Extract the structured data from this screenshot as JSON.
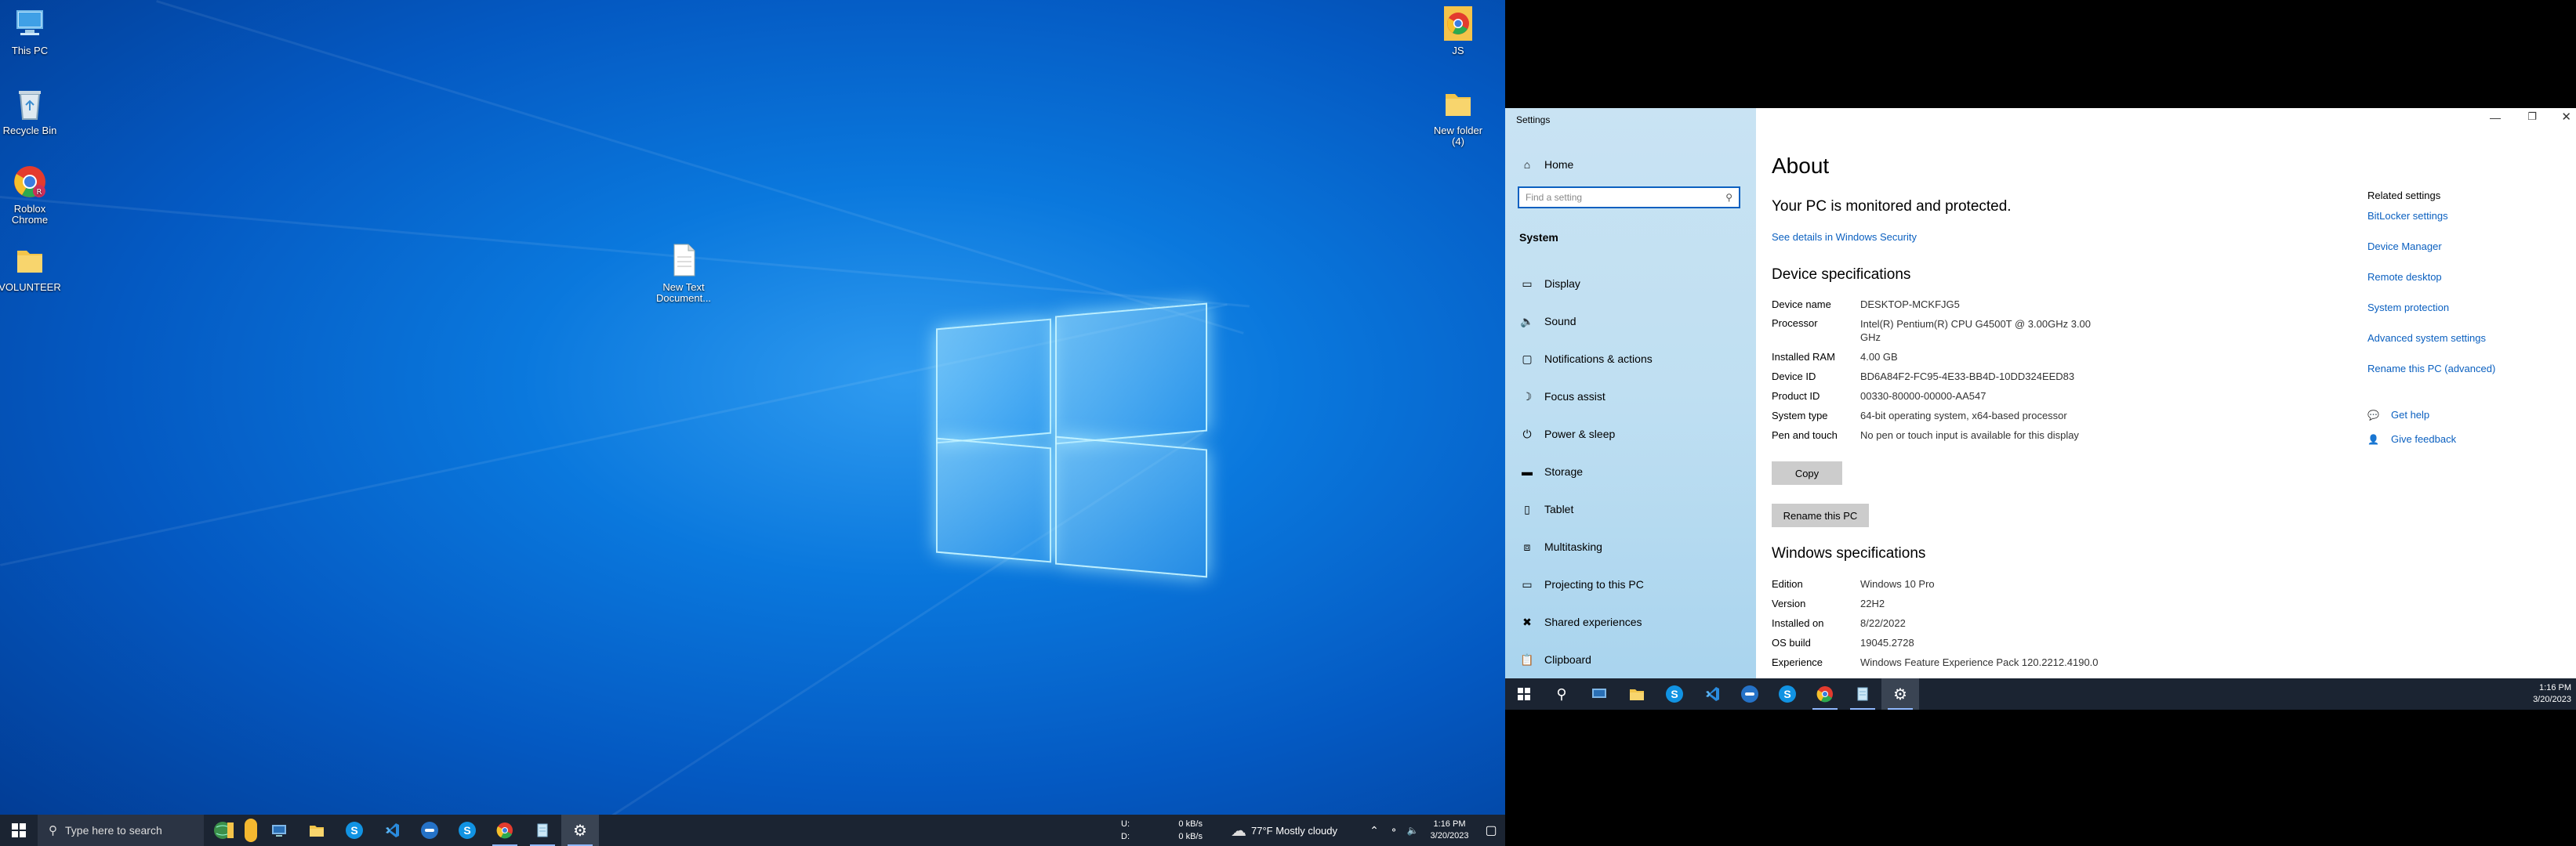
{
  "left": {
    "desktop_icons": [
      {
        "label": "This PC",
        "icon": "computer-icon"
      },
      {
        "label": "Recycle Bin",
        "icon": "recycle-bin-icon"
      },
      {
        "label": "Roblox Chrome",
        "icon": "chrome-icon"
      },
      {
        "label": "VOLUNTEER",
        "icon": "folder-icon"
      },
      {
        "label": "New Text Document...",
        "icon": "text-file-icon"
      },
      {
        "label": "JS",
        "icon": "chrome-icon"
      },
      {
        "label": "New folder (4)",
        "icon": "folder-icon"
      }
    ],
    "taskbar": {
      "search_placeholder": "Type here to search",
      "net_up_label": "U:",
      "net_down_label": "D:",
      "net_up_value": "0 kB/s",
      "net_down_value": "0 kB/s",
      "weather": "77°F  Mostly cloudy",
      "time": "1:16 PM",
      "date": "3/20/2023"
    }
  },
  "settings": {
    "window_title": "Settings",
    "nav": {
      "home": "Home",
      "search_placeholder": "Find a setting",
      "section": "System",
      "items": [
        "Display",
        "Sound",
        "Notifications & actions",
        "Focus assist",
        "Power & sleep",
        "Storage",
        "Tablet",
        "Multitasking",
        "Projecting to this PC",
        "Shared experiences",
        "Clipboard"
      ]
    },
    "about": {
      "title": "About",
      "protected": "Your PC is monitored and protected.",
      "security_link": "See details in Windows Security",
      "device_heading": "Device specifications",
      "device_specs": [
        {
          "label": "Device name",
          "value": "DESKTOP-MCKFJG5"
        },
        {
          "label": "Processor",
          "value": "Intel(R) Pentium(R) CPU G4500T @ 3.00GHz   3.00 GHz"
        },
        {
          "label": "Installed RAM",
          "value": "4.00 GB"
        },
        {
          "label": "Device ID",
          "value": "BD6A84F2-FC95-4E33-BB4D-10DD324EED83"
        },
        {
          "label": "Product ID",
          "value": "00330-80000-00000-AA547"
        },
        {
          "label": "System type",
          "value": "64-bit operating system, x64-based processor"
        },
        {
          "label": "Pen and touch",
          "value": "No pen or touch input is available for this display"
        }
      ],
      "copy_button": "Copy",
      "rename_button": "Rename this PC",
      "windows_heading": "Windows specifications",
      "windows_specs": [
        {
          "label": "Edition",
          "value": "Windows 10 Pro"
        },
        {
          "label": "Version",
          "value": "22H2"
        },
        {
          "label": "Installed on",
          "value": "8/22/2022"
        },
        {
          "label": "OS build",
          "value": "19045.2728"
        },
        {
          "label": "Experience",
          "value": "Windows Feature Experience Pack 120.2212.4190.0"
        }
      ]
    },
    "related": {
      "heading": "Related settings",
      "links": [
        "BitLocker settings",
        "Device Manager",
        "Remote desktop",
        "System protection",
        "Advanced system settings",
        "Rename this PC (advanced)"
      ],
      "help": "Get help",
      "feedback": "Give feedback"
    }
  },
  "right_taskbar": {
    "time": "1:16 PM",
    "date": "3/20/2023"
  },
  "colors": {
    "link": "#0b60c0",
    "taskbar": "#1b2432",
    "nav_bg": "#c0dff2"
  }
}
